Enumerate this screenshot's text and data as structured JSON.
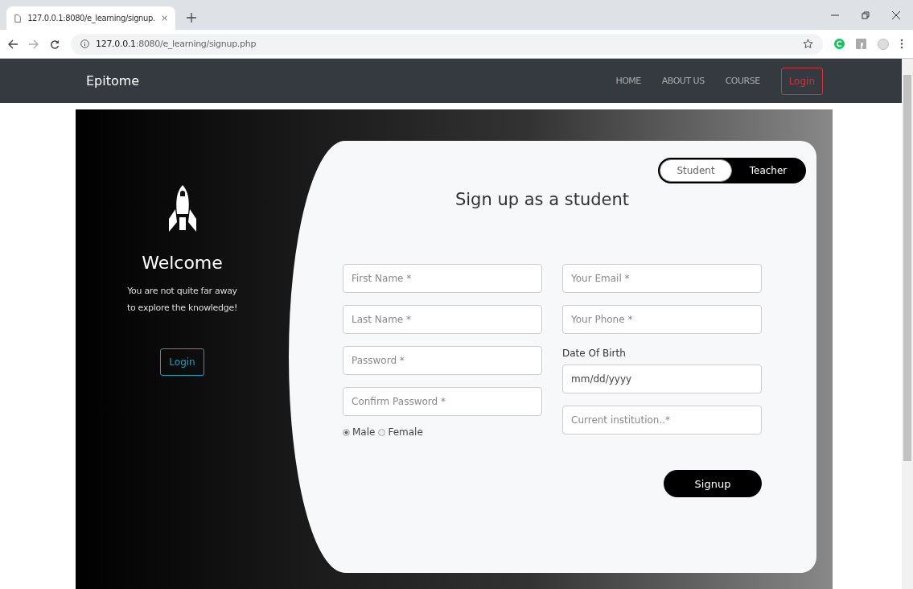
{
  "browser": {
    "tab_title": "127.0.0.1:8080/e_learning/signup.",
    "address_host": "127.0.0.1",
    "address_rest": ":8080/e_learning/signup.php"
  },
  "navbar": {
    "brand": "Epitome",
    "links": [
      {
        "label": "HOME",
        "kind": "link"
      },
      {
        "label": "ABOUT US",
        "kind": "link"
      },
      {
        "label": "COURSE",
        "kind": "link"
      },
      {
        "label": "Login",
        "kind": "outline"
      }
    ]
  },
  "welcome": {
    "title": "Welcome",
    "text": "You are not quite far away to explore the knowledge!",
    "button": "Login"
  },
  "role_toggle": [
    {
      "label": "Student",
      "selected": true
    },
    {
      "label": "Teacher",
      "selected": false
    }
  ],
  "form": {
    "title": "Sign up as a student",
    "left_fields": [
      {
        "placeholder": "First Name *"
      },
      {
        "placeholder": "Last Name *"
      },
      {
        "placeholder": "Password *"
      },
      {
        "placeholder": "Confirm Password *"
      }
    ],
    "gender": [
      {
        "label": "Male",
        "selected": true
      },
      {
        "label": "Female",
        "selected": false
      }
    ],
    "right_fields": [
      {
        "kind": "input",
        "placeholder": "Your Email *"
      },
      {
        "kind": "input",
        "placeholder": "Your Phone *"
      },
      {
        "kind": "label",
        "label": "Date Of Birth"
      },
      {
        "kind": "date",
        "value": "mm/dd/yyyy"
      },
      {
        "kind": "input",
        "placeholder": "Current institution..*"
      }
    ],
    "submit": "Signup"
  }
}
